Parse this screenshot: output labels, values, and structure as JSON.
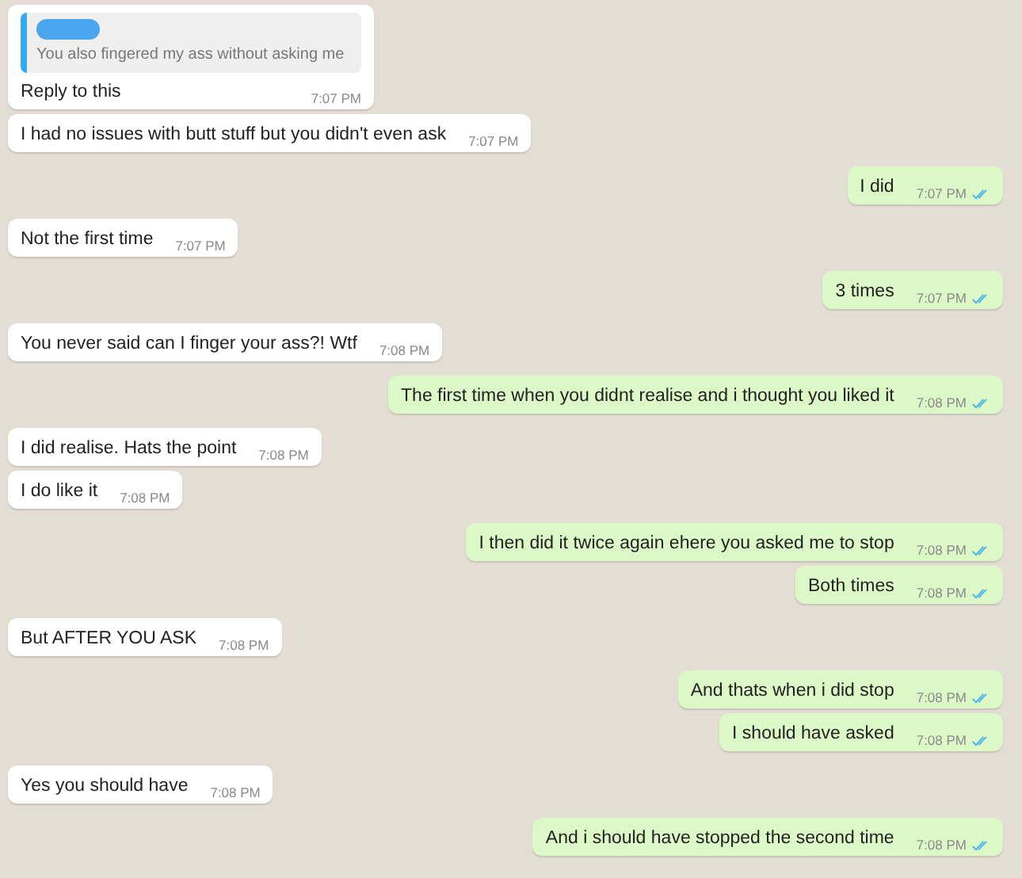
{
  "messages": [
    {
      "kind": "incoming",
      "quote": {
        "text": "You also fingered my ass without asking me"
      },
      "text": "Reply to this",
      "time": "7:07 PM"
    },
    {
      "kind": "incoming",
      "text": "I had no issues with butt stuff but you didn't even ask",
      "time": "7:07 PM"
    },
    {
      "kind": "outgoing",
      "text": "I did",
      "time": "7:07 PM",
      "read": true
    },
    {
      "kind": "incoming",
      "text": "Not the first time",
      "time": "7:07 PM"
    },
    {
      "kind": "outgoing",
      "text": "3 times",
      "time": "7:07 PM",
      "read": true
    },
    {
      "kind": "incoming",
      "text": "You never said can I finger your ass?! Wtf",
      "time": "7:08 PM"
    },
    {
      "kind": "outgoing",
      "text": "The first time when you didnt realise and i thought you liked it",
      "time": "7:08 PM",
      "read": true
    },
    {
      "kind": "incoming",
      "text": "I did realise. Hats the point",
      "time": "7:08 PM"
    },
    {
      "kind": "incoming",
      "text": "I do like it",
      "time": "7:08 PM"
    },
    {
      "kind": "outgoing",
      "text": "I then did it twice again ehere you asked me to stop",
      "time": "7:08 PM",
      "read": true
    },
    {
      "kind": "outgoing",
      "text": "Both times",
      "time": "7:08 PM",
      "read": true
    },
    {
      "kind": "incoming",
      "text": "But AFTER YOU ASK",
      "time": "7:08 PM"
    },
    {
      "kind": "outgoing",
      "text": "And thats when i did stop",
      "time": "7:08 PM",
      "read": true
    },
    {
      "kind": "outgoing",
      "text": "I should have asked",
      "time": "7:08 PM",
      "read": true
    },
    {
      "kind": "incoming",
      "text": "Yes you should have",
      "time": "7:08 PM"
    },
    {
      "kind": "outgoing",
      "text": "And i should have stopped the second time",
      "time": "7:08 PM",
      "read": true
    }
  ]
}
